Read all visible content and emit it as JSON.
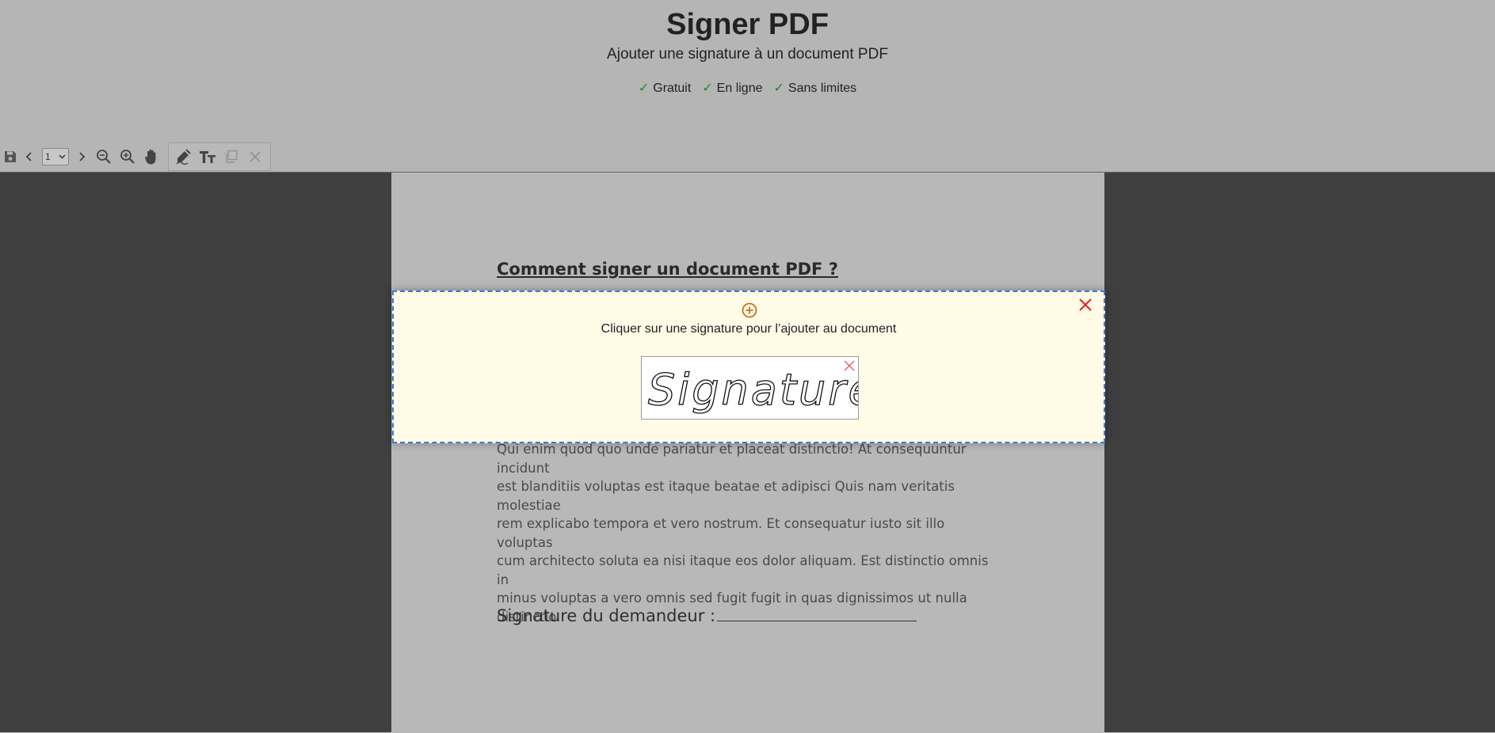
{
  "header": {
    "title": "Signer PDF",
    "subtitle": "Ajouter une signature à un document PDF",
    "features": [
      {
        "check": "✓",
        "label": "Gratuit"
      },
      {
        "check": "✓",
        "label": "En ligne"
      },
      {
        "check": "✓",
        "label": "Sans limites"
      }
    ]
  },
  "toolbar": {
    "save_icon": "save-icon",
    "prev_icon": "chevron-left-icon",
    "page_value": "1",
    "next_icon": "chevron-right-icon",
    "zoom_out_icon": "zoom-out-icon",
    "zoom_in_icon": "zoom-in-icon",
    "hand_icon": "hand-icon",
    "sign_icon": "signature-pen-icon",
    "text_icon": "text-icon",
    "copy_icon": "copy-icon",
    "delete_icon": "close-icon"
  },
  "document": {
    "heading": "Comment signer un document PDF ?",
    "paragraph_lines": [
      "Qui enim quod quo unde pariatur et placeat distinctio! At consequuntur incidunt",
      "est blanditiis voluptas est itaque beatae et adipisci Quis nam veritatis molestiae",
      "rem explicabo tempora et vero nostrum. Et consequatur iusto sit illo voluptas",
      "cum architecto soluta ea nisi itaque eos dolor aliquam. Est distinctio omnis in",
      "minus voluptas a vero omnis sed fugit fugit in quas dignissimos ut nulla",
      "distinctio."
    ],
    "signature_label": "Signature du demandeur :"
  },
  "signature_panel": {
    "instruction": "Cliquer sur une signature pour l’ajouter au document",
    "signature_text": "Signature"
  },
  "colors": {
    "header_bg": "#b5b5b5",
    "viewer_bg": "#3f3f3f",
    "page_bg": "#b8b8b8",
    "panel_bg": "#fffbe6",
    "panel_border": "#3a7bd5",
    "close_red": "#e02020",
    "add_orange": "#c8701a",
    "check_green": "#3a7a3a"
  }
}
